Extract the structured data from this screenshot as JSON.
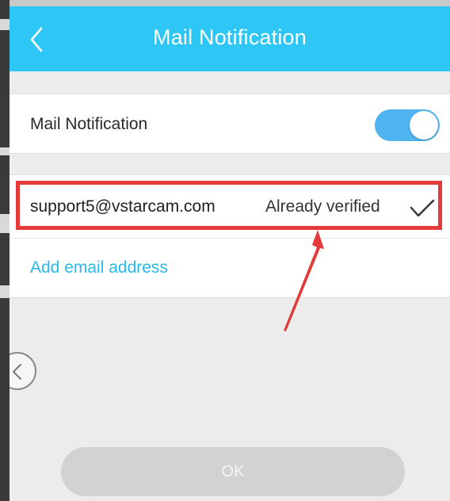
{
  "header": {
    "title": "Mail Notification",
    "back_icon": "chevron-left-icon"
  },
  "notification": {
    "label": "Mail Notification",
    "enabled": true
  },
  "email": {
    "address": "support5@vstarcam.com",
    "status": "Already verified",
    "status_icon": "check-icon"
  },
  "add_email": {
    "label": "Add email address"
  },
  "ok_button": {
    "label": "OK"
  },
  "colors": {
    "header_bg": "#2ec7f5",
    "toggle_on": "#4fb3f0",
    "link": "#29b9ea",
    "annotation": "#e53a3a",
    "button_disabled": "#d2d2d2"
  }
}
